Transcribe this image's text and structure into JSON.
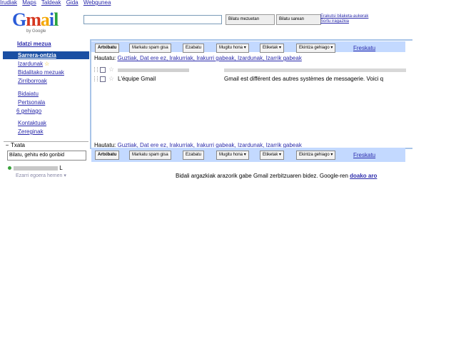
{
  "topnav": [
    "Irudiak",
    "Maps",
    "Taldeak",
    "Gida",
    "Webgunea"
  ],
  "logo": {
    "text": "Gmail",
    "byline": "by Google"
  },
  "search": {
    "value": "",
    "search_mail": "Bilatu mezuetan",
    "search_web": "Bilatu sarean",
    "show_options": "Erakutsi bilaketa-aukerak",
    "create_filter": "Sortu iragazkia"
  },
  "sidebar": {
    "compose": "Idatzi mezua",
    "inbox": "Sarrera-ontzia",
    "items_main": [
      "Izardunak",
      "Bidalitako mezuak",
      "Zirriborroak"
    ],
    "items_labels": [
      "Bidaiatu",
      "Pertsonala",
      "6 gehiago"
    ],
    "items_bottom": [
      "Kontaktuak",
      "Zereginak"
    ]
  },
  "chat": {
    "header": "Txata",
    "collapse_symbol": "−",
    "search_value": "Bilatu, gehitu edo gonbid",
    "contact_suffix": "L",
    "status": "Ezarri egoera hemen ▾"
  },
  "toolbar": {
    "archive": "Artxibatu",
    "spam": "Markatu spam gisa",
    "delete": "Ezabatu",
    "move": "Mugitu hona ▾",
    "labels": "Etiketak ▾",
    "more": "Ekintza gehiago ▾",
    "refresh": "Freskatu"
  },
  "select": {
    "prefix": "Hautatu:",
    "options": "Guztiak, Dat ere ez, Irakurriak, Irakurri gabeak, Izardunak, Izarrik gabeak"
  },
  "messages": [
    {
      "sender": "",
      "snippet": ""
    },
    {
      "sender": "L'équipe Gmail",
      "snippet": "Gmail est différent des autres systèmes de messagerie. Voici q"
    }
  ],
  "footer": {
    "text": "Bidali argazkiak arazorik gabe Gmail zerbitzuaren bidez. Google-ren ",
    "link": "doako aro"
  },
  "colors": {
    "toolbar_bg": "#c3d9ff",
    "inbox_highlight": "#1a4fa3",
    "link": "#2a2aab",
    "logo_g": "#2a5bd7",
    "logo_m": "#d6371f"
  }
}
